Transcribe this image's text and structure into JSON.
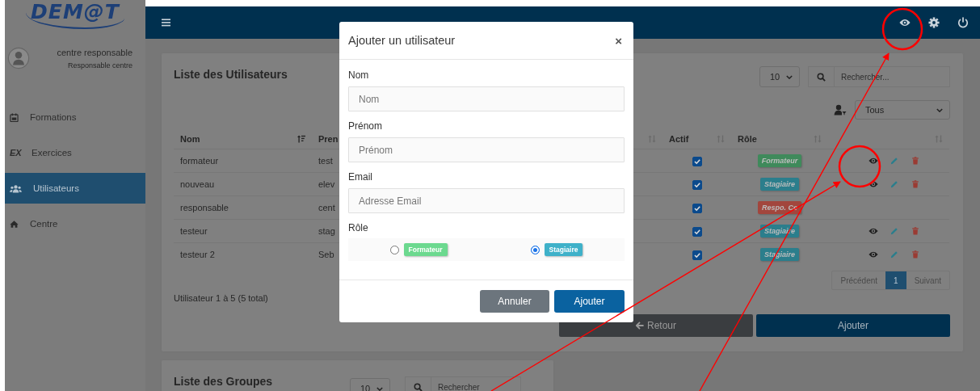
{
  "sidebar": {
    "logo": "DEM@T",
    "user": {
      "name": "centre responsable",
      "role": "Responsable centre"
    },
    "items": [
      {
        "label": "Formations",
        "selected": false
      },
      {
        "label": "Exercices",
        "icon_text": "EX",
        "selected": false
      },
      {
        "label": "Utilisateurs",
        "selected": true
      },
      {
        "label": "Centre",
        "selected": false
      }
    ]
  },
  "users_card": {
    "title": "Liste des Utilisateurs",
    "page_size": "10",
    "search_placeholder": "Rechercher...",
    "role_filter": "Tous",
    "columns": [
      {
        "label": "Nom",
        "sorted": true
      },
      {
        "label": "Pren"
      },
      {
        "sorted": false
      },
      {
        "label": "Actif",
        "sorted": false
      },
      {
        "label": "Rôle",
        "sorted": false
      },
      {
        "sorted": false
      }
    ],
    "rows": [
      {
        "nom": "formateur",
        "prenom": "test",
        "actif": true,
        "role": {
          "label": "Formateur",
          "kind": "formateur"
        },
        "actions": true
      },
      {
        "nom": "nouveau",
        "prenom": "elev",
        "actif": true,
        "role": {
          "label": "Stagiaire",
          "kind": "stagiaire"
        },
        "actions": true
      },
      {
        "nom": "responsable",
        "prenom": "cent",
        "actif": true,
        "role": {
          "label": "Respo. Ce",
          "kind": "responsable"
        },
        "actions": false
      },
      {
        "nom": "testeur",
        "prenom": "stag",
        "actif": true,
        "role": {
          "label": "Stagiaire",
          "kind": "stagiaire"
        },
        "actions": true
      },
      {
        "nom": "testeur 2",
        "prenom": "Seb",
        "actif": true,
        "role": {
          "label": "Stagiaire",
          "kind": "stagiaire"
        },
        "actions": true
      }
    ],
    "info": "Utilisateur 1 à 5 (5 total)",
    "pagination": [
      {
        "label": "Précédent",
        "selected": false
      },
      {
        "label": "1",
        "selected": true
      },
      {
        "label": "Suivant",
        "selected": false
      }
    ],
    "back_button": "Retour",
    "add_button": "Ajouter"
  },
  "groups_card": {
    "title": "Liste des Groupes",
    "page_size": "10",
    "search_placeholder": "Rechercher"
  },
  "modal": {
    "title": "Ajouter un utilisateur",
    "close": "×",
    "fields": [
      {
        "label": "Nom",
        "placeholder": "Nom"
      },
      {
        "label": "Prénom",
        "placeholder": "Prénom"
      },
      {
        "label": "Email",
        "placeholder": "Adresse Email"
      }
    ],
    "role_label": "Rôle",
    "roles": [
      {
        "label": "Formateur",
        "kind": "formateur",
        "selected": false
      },
      {
        "label": "Stagiaire",
        "kind": "stagiaire",
        "selected": true
      }
    ],
    "cancel": "Annuler",
    "submit": "Ajouter"
  }
}
